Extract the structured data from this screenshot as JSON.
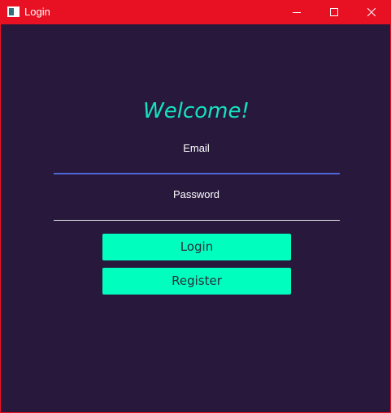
{
  "window": {
    "title": "Login",
    "controls": {
      "minimize_icon": "minimize-icon",
      "maximize_icon": "maximize-icon",
      "close_icon": "close-icon"
    }
  },
  "form": {
    "heading": "Welcome!",
    "email_label": "Email",
    "email_value": "",
    "password_label": "Password",
    "password_value": "",
    "login_button": "Login",
    "register_button": "Register"
  },
  "colors": {
    "titlebar": "#e81123",
    "background": "#27183c",
    "accent_text": "#15e3bf",
    "button": "#00ffbf",
    "focused_underline": "#4f66d6",
    "underline": "#e8e8ec"
  }
}
